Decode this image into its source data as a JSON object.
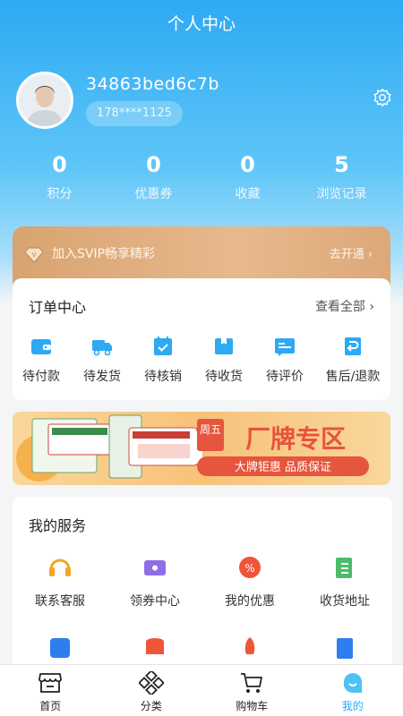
{
  "header": {
    "title": "个人中心"
  },
  "user": {
    "id": "34863bed6c7b",
    "phone": "178****1125"
  },
  "stats": [
    {
      "value": "0",
      "label": "积分"
    },
    {
      "value": "0",
      "label": "优惠券"
    },
    {
      "value": "0",
      "label": "收藏"
    },
    {
      "value": "5",
      "label": "浏览记录"
    }
  ],
  "vip": {
    "text": "加入SVIP畅享精彩",
    "action": "去开通 ›"
  },
  "orders": {
    "title": "订单中心",
    "more": "查看全部 ›",
    "items": [
      {
        "label": "待付款",
        "icon": "wallet-icon"
      },
      {
        "label": "待发货",
        "icon": "truck-icon"
      },
      {
        "label": "待核销",
        "icon": "calendar-check-icon"
      },
      {
        "label": "待收货",
        "icon": "box-icon"
      },
      {
        "label": "待评价",
        "icon": "comment-card-icon"
      },
      {
        "label": "售后/退款",
        "icon": "refund-icon"
      }
    ]
  },
  "banner": {
    "day": "周五",
    "title": "厂牌专区",
    "slogan": "大牌钜惠 品质保证"
  },
  "services": {
    "title": "我的服务",
    "items": [
      {
        "label": "联系客服",
        "icon": "headset-icon"
      },
      {
        "label": "领券中心",
        "icon": "coupon-icon"
      },
      {
        "label": "我的优惠",
        "icon": "discount-icon"
      },
      {
        "label": "收货地址",
        "icon": "address-book-icon"
      }
    ]
  },
  "tabbar": [
    {
      "label": "首页",
      "icon": "store-icon"
    },
    {
      "label": "分类",
      "icon": "category-icon"
    },
    {
      "label": "购物车",
      "icon": "cart-icon"
    },
    {
      "label": "我的",
      "icon": "profile-icon"
    }
  ],
  "colors": {
    "primary": "#2ea9f3",
    "vip": "#dca878",
    "accent": "#f0553a"
  }
}
